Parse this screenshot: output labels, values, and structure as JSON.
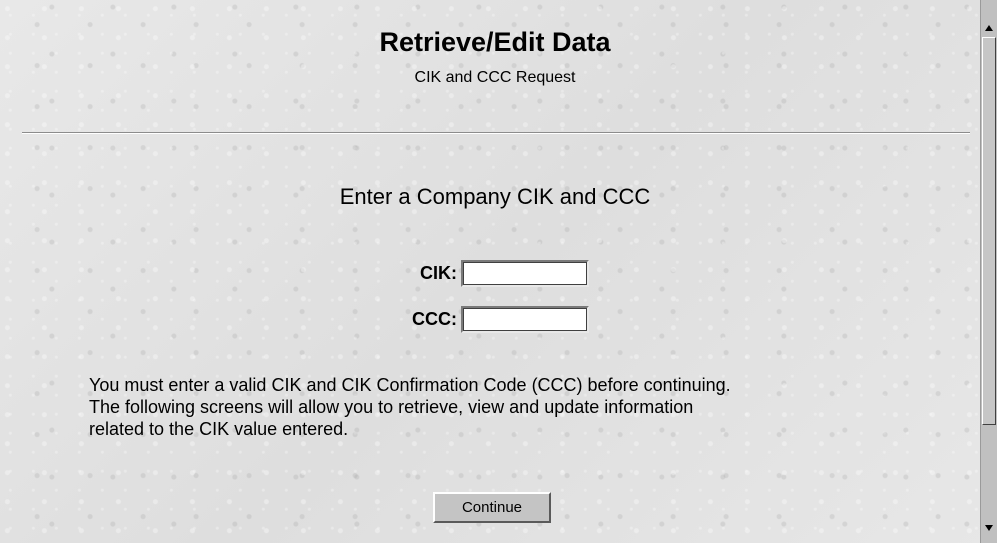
{
  "header": {
    "title": "Retrieve/Edit Data",
    "subtitle": "CIK and CCC Request"
  },
  "form": {
    "heading": "Enter a Company CIK and CCC",
    "cik_label": "CIK:",
    "cik_value": "",
    "ccc_label": "CCC:",
    "ccc_value": "",
    "instructions": [
      "You must enter a valid CIK and CIK Confirmation Code (CCC) before continuing.",
      "The following screens will allow you to retrieve, view and update information",
      "related to the CIK value entered."
    ],
    "continue_label": "Continue"
  },
  "scrollbar": {
    "up_icon": "triangle-up-icon",
    "down_icon": "triangle-down-icon"
  },
  "colors": {
    "background": "#e4e4e4",
    "button_face": "#c4c4c4",
    "divider": "#8c8c8c"
  }
}
